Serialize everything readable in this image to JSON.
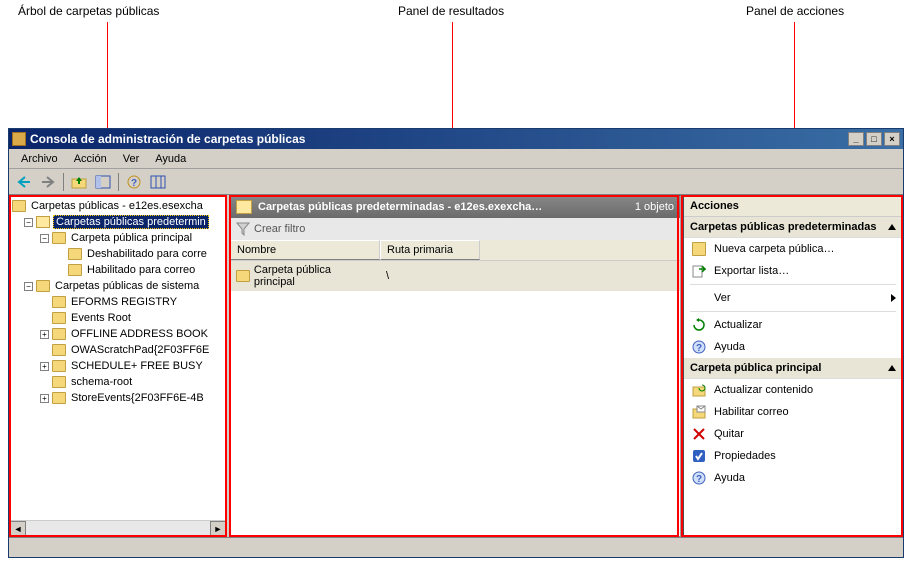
{
  "callouts": {
    "tree": "Árbol de carpetas públicas",
    "results": "Panel de resultados",
    "actions": "Panel de acciones"
  },
  "window": {
    "title": "Consola de administración de carpetas públicas"
  },
  "menu": {
    "archivo": "Archivo",
    "accion": "Acción",
    "ver": "Ver",
    "ayuda": "Ayuda"
  },
  "tree": {
    "root": "Carpetas públicas - e12es.esexcha",
    "default_folders": "Carpetas públicas predetermin",
    "main_folder": "Carpeta pública principal",
    "mail_disabled": "Deshabilitado para corre",
    "mail_enabled": "Habilitado para correo",
    "system_folders": "Carpetas públicas de sistema",
    "eforms": "EFORMS REGISTRY",
    "events_root": "Events Root",
    "oab": "OFFLINE ADDRESS BOOK",
    "owascratch": "OWAScratchPad{2F03FF6E",
    "schedule": "SCHEDULE+ FREE BUSY",
    "schema": "schema-root",
    "storeevents": "StoreEvents{2F03FF6E-4B"
  },
  "results": {
    "header_title": "Carpetas públicas predeterminadas - e12es.exexcha…",
    "header_count": "1 objeto",
    "filter_label": "Crear filtro",
    "col_name": "Nombre",
    "col_path": "Ruta primaria",
    "row_name": "Carpeta pública principal",
    "row_path": "\\"
  },
  "actions": {
    "title": "Acciones",
    "section1": "Carpetas públicas predeterminadas",
    "new_folder": "Nueva carpeta pública…",
    "export": "Exportar lista…",
    "ver": "Ver",
    "refresh": "Actualizar",
    "help1": "Ayuda",
    "section2": "Carpeta pública principal",
    "update_content": "Actualizar contenido",
    "enable_mail": "Habilitar correo",
    "remove": "Quitar",
    "properties": "Propiedades",
    "help2": "Ayuda"
  }
}
